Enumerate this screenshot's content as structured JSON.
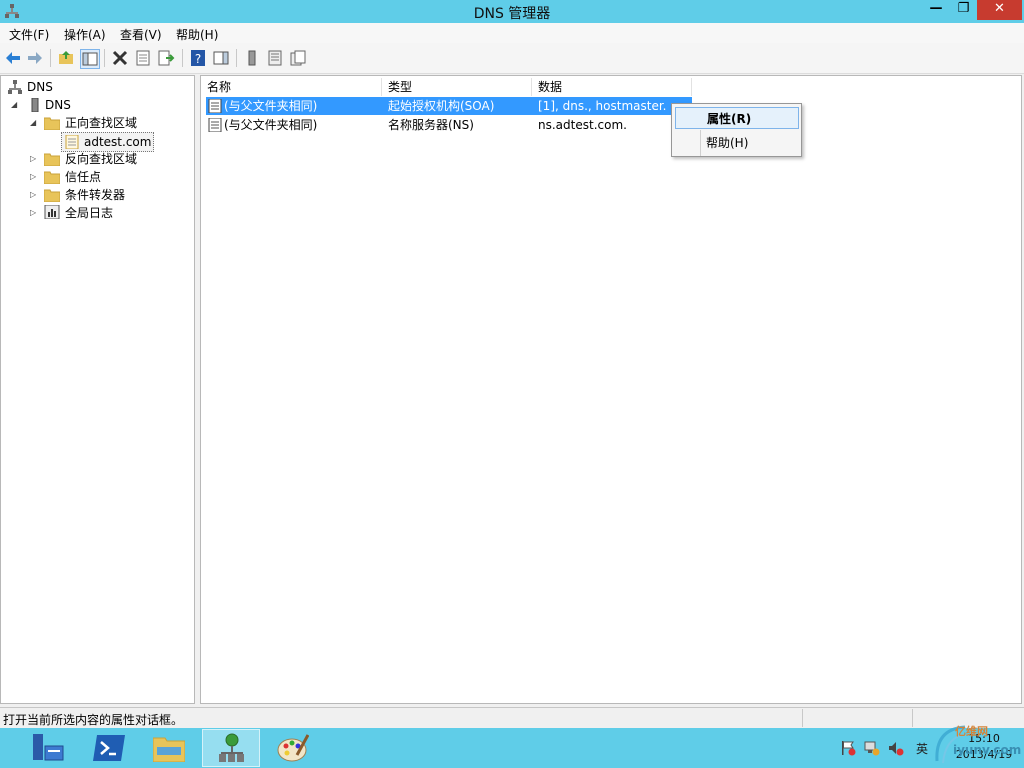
{
  "window": {
    "title": "DNS 管理器",
    "controls": {
      "minimize": "—",
      "maximize": "❐",
      "close": "✕"
    }
  },
  "menu": [
    "文件(F)",
    "操作(A)",
    "查看(V)",
    "帮助(H)"
  ],
  "toolbar": {
    "icons": [
      "back-arrow-icon",
      "forward-arrow-icon",
      "up-folder-icon",
      "show-hide-tree-icon",
      "delete-icon",
      "properties-icon",
      "export-list-icon",
      "help-icon",
      "show-hide-action-pane-icon",
      "server-icon",
      "zone-icon",
      "records-icon"
    ]
  },
  "tree": {
    "root": "DNS",
    "server": "DNS",
    "forward_zones": "正向查找区域",
    "selected_zone": "adtest.com",
    "reverse_zones": "反向查找区域",
    "trust_points": "信任点",
    "conditional_forwarders": "条件转发器",
    "global_logs": "全局日志"
  },
  "list": {
    "columns": [
      "名称",
      "类型",
      "数据"
    ],
    "rows": [
      {
        "name": "(与父文件夹相同)",
        "type": "起始授权机构(SOA)",
        "data": "[1], dns., hostmaster.",
        "selected": true
      },
      {
        "name": "(与父文件夹相同)",
        "type": "名称服务器(NS)",
        "data": "ns.adtest.com.",
        "selected": false
      }
    ]
  },
  "context_menu": {
    "properties": "属性(R)",
    "help": "帮助(H)"
  },
  "status": {
    "text": "打开当前所选内容的属性对话框。"
  },
  "taskbar": {
    "apps": [
      "server-manager-icon",
      "powershell-icon",
      "file-explorer-icon",
      "dns-manager-icon",
      "paint-icon"
    ],
    "active_app": "dns-manager-icon",
    "tray_icons": [
      "flag-icon",
      "network-icon",
      "speaker-icon",
      "ime-icon"
    ],
    "time": "15:10",
    "date": "2013/4/19"
  },
  "watermark": {
    "line1": "亿维网",
    "line2": "iyunv.com"
  },
  "colors": {
    "accent": "#5fcde8",
    "selection": "#3399ff",
    "close_button": "#c73b2f"
  }
}
